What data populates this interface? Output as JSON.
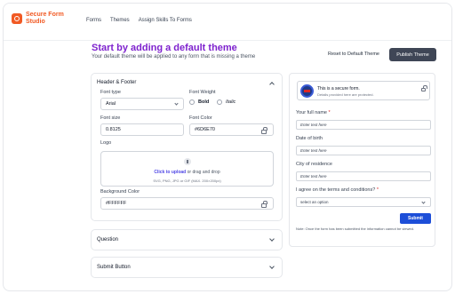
{
  "app": {
    "name_line1": "Secure Form",
    "name_line2": "Studio",
    "brand_color": "#f15a24"
  },
  "nav": {
    "items": [
      "Forms",
      "Themes",
      "Assign Skills To Forms"
    ]
  },
  "page": {
    "title": "Start by adding a default theme",
    "subtitle": "Your default theme will be applied to any form that is missing a theme",
    "reset_label": "Reset to Default Theme",
    "publish_label": "Publish Theme"
  },
  "header_footer": {
    "title": "Header & Footer",
    "font_type_label": "Font type",
    "font_type_value": "Arial",
    "font_weight_label": "Font Weight",
    "weight_bold": "Bold",
    "weight_italic": "Italic",
    "font_size_label": "Font size",
    "font_size_value": "0.8125",
    "font_color_label": "Font Color",
    "font_color_value": "#6D6E70",
    "logo_label": "Logo",
    "upload_link": "Click to upload",
    "upload_rest": " or drag and drop",
    "upload_hint": "SVG, PNG, JPG or GIF (MAX. 200×200px)",
    "bg_color_label": "Background Color",
    "bg_color_value": "#FFFFFF"
  },
  "sections": {
    "question": "Question",
    "submit_button": "Submit Button"
  },
  "preview": {
    "secure_title": "This is a secure form.",
    "secure_sub": "Details provided here are protected.",
    "full_name_label": "Your full name ",
    "required_mark": "*",
    "full_name_placeholder": "Enter text here",
    "dob_label": "Date of birth",
    "dob_placeholder": "Enter text here",
    "city_label": "City of residence",
    "city_placeholder": "Enter text here",
    "terms_label": "I agree on the terms and conditions? ",
    "terms_select": "select an option",
    "submit_label": "Submit",
    "note": "Note: Once the form has been submitted the information cannot be viewed."
  }
}
